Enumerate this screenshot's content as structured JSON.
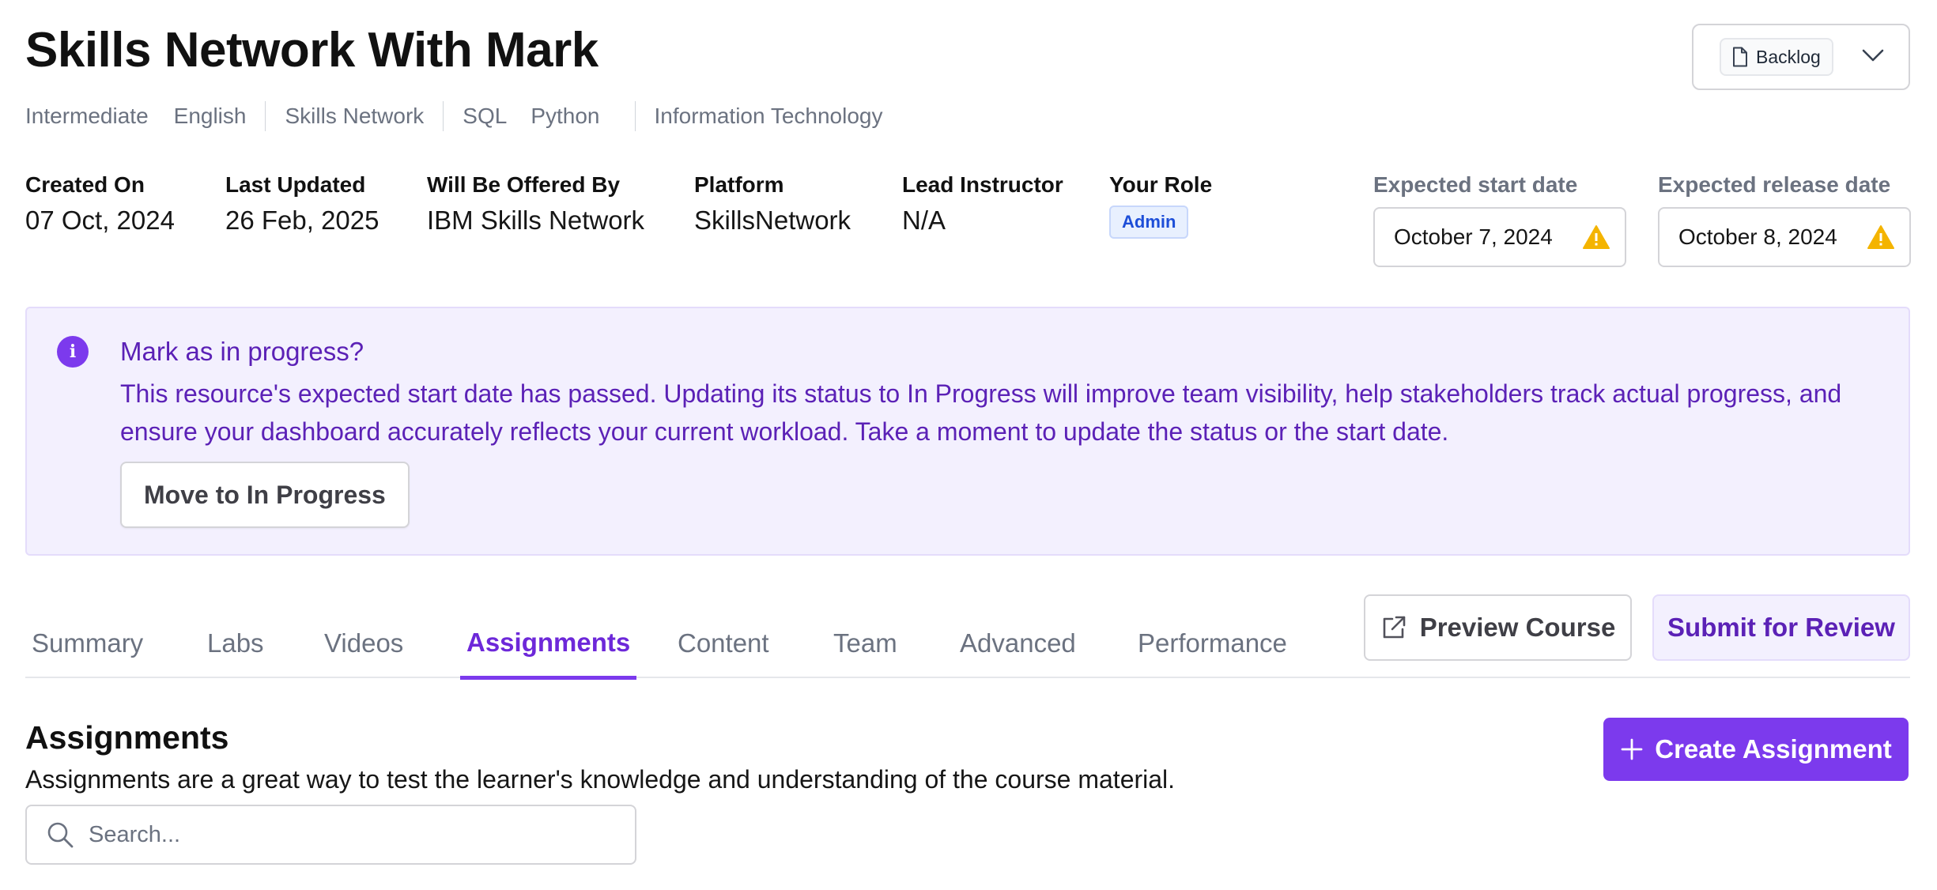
{
  "page": {
    "title": "Skills Network With Mark"
  },
  "tags": [
    "Intermediate",
    "English",
    "Skills Network",
    "SQL",
    "Python",
    "Information Technology"
  ],
  "status": {
    "label": "Backlog",
    "icon": "document-icon",
    "dropdown_icon": "chevron-down-icon"
  },
  "meta": {
    "created_on": {
      "label": "Created On",
      "value": "07 Oct, 2024"
    },
    "last_updated": {
      "label": "Last Updated",
      "value": "26 Feb, 2025"
    },
    "offered_by": {
      "label": "Will Be Offered By",
      "value": "IBM Skills Network"
    },
    "platform": {
      "label": "Platform",
      "value": "SkillsNetwork"
    },
    "lead_instructor": {
      "label": "Lead Instructor",
      "value": "N/A"
    },
    "your_role": {
      "label": "Your Role",
      "value": "Admin"
    }
  },
  "dates": {
    "start": {
      "label": "Expected start date",
      "value": "October 7, 2024",
      "icon": "warning-icon"
    },
    "release": {
      "label": "Expected release date",
      "value": "October 8, 2024",
      "icon": "warning-icon"
    }
  },
  "banner": {
    "icon": "info-icon",
    "title": "Mark as in progress?",
    "text": "This resource's expected start date has passed. Updating its status to In Progress will improve team visibility, help stakeholders track actual progress, and ensure your dashboard accurately reflects your current workload. Take a moment to update the status or the start date.",
    "button": "Move to In Progress"
  },
  "tabs": [
    "Summary",
    "Labs",
    "Videos",
    "Assignments",
    "Content",
    "Team",
    "Advanced",
    "Performance"
  ],
  "active_tab": "Assignments",
  "actions": {
    "preview": "Preview Course",
    "submit": "Submit for Review"
  },
  "assignments": {
    "title": "Assignments",
    "description": "Assignments are a great way to test the learner's knowledge and understanding of the course material.",
    "create_button": "Create Assignment",
    "search_placeholder": "Search..."
  },
  "colors": {
    "accent": "#7c3aed",
    "banner_bg": "#f3f0fe",
    "banner_text": "#5b21b6",
    "warning": "#f4b400"
  }
}
